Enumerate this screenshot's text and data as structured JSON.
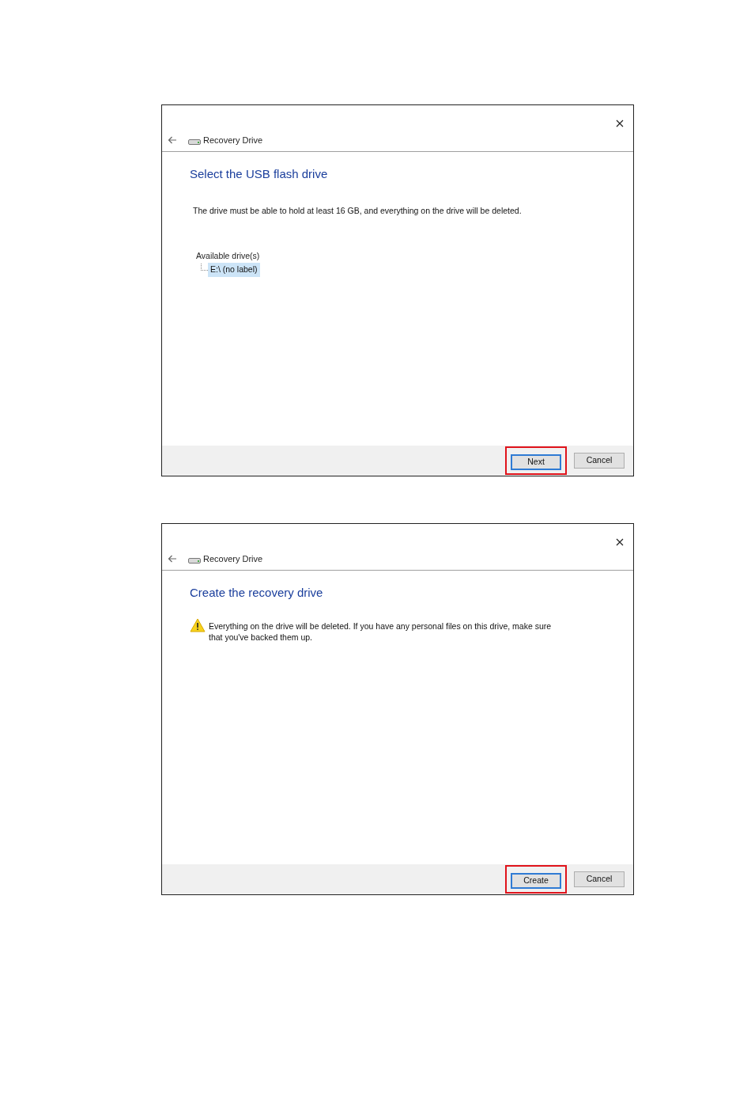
{
  "dialogs": [
    {
      "title": "Recovery Drive",
      "heading": "Select the USB flash drive",
      "warning": false,
      "message": "The drive must be able to hold at least 16 GB, and everything on the drive will be deleted.",
      "drives_label": "Available drive(s)",
      "drives": [
        {
          "label": "E:\\ (no label)",
          "selected": true
        }
      ],
      "buttons": [
        {
          "label": "Next",
          "default": true,
          "highlighted": true
        },
        {
          "label": "Cancel",
          "default": false,
          "highlighted": false
        }
      ]
    },
    {
      "title": "Recovery Drive",
      "heading": "Create the recovery drive",
      "warning": true,
      "message": "Everything on the drive will be deleted. If you have any personal files on this drive, make sure that you've backed them up.",
      "buttons": [
        {
          "label": "Create",
          "default": true,
          "highlighted": true
        },
        {
          "label": "Cancel",
          "default": false,
          "highlighted": false
        }
      ]
    }
  ]
}
